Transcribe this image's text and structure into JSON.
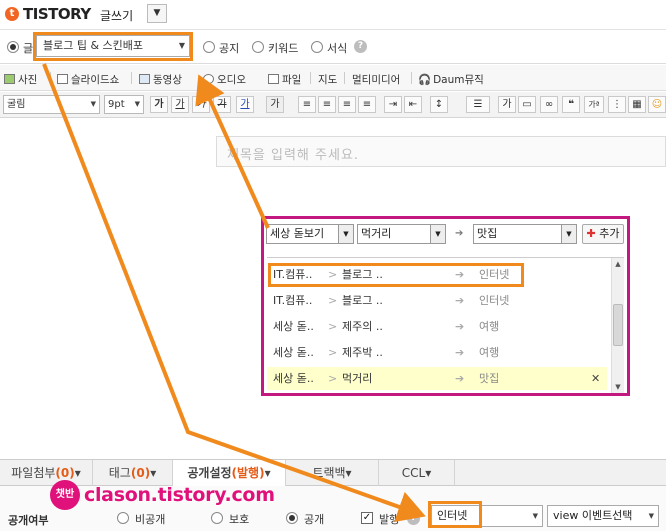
{
  "app": {
    "logo_badge": "t",
    "logo": "TISTORY",
    "subtitle": "글쓰기",
    "dropdown_arrow": "▼"
  },
  "category_row": {
    "type_selected": "글",
    "category_value": "블로그 팁 & 스킨배포",
    "options": [
      "공지",
      "키워드",
      "서식"
    ],
    "help": "?"
  },
  "media_toolbar": [
    "사진",
    "슬라이드쇼",
    "동영상",
    "오디오",
    "파일",
    "지도",
    "멀티미디어",
    "Daum뮤직"
  ],
  "format_toolbar": {
    "font": "굴림",
    "size": "9pt",
    "buttons": [
      "가",
      "가",
      "가",
      "가",
      "가",
      "가",
      "가"
    ]
  },
  "editor": {
    "title_placeholder": "제목을 입력해 주세요."
  },
  "panel": {
    "select1": "세상 돋보기",
    "select2": "먹거리",
    "select3": "맛집",
    "arrow": "➔",
    "add_label": "추가",
    "add_plus": "✚",
    "rows": [
      {
        "c1": "IT.컴퓨..",
        "c2": "블로그 ..",
        "c3": "인터넷"
      },
      {
        "c1": "IT.컴퓨..",
        "c2": "블로그 ..",
        "c3": "인터넷"
      },
      {
        "c1": "세상 돋..",
        "c2": "제주의 ..",
        "c3": "여행"
      },
      {
        "c1": "세상 돋..",
        "c2": "제주박 ..",
        "c3": "여행"
      },
      {
        "c1": "세상 돋..",
        "c2": "먹거리",
        "c3": "맛집",
        "remove": "✕"
      }
    ],
    "sep": ">",
    "sep_arrow": "➔"
  },
  "tabs": [
    {
      "label": "파일첨부",
      "count": "(0)"
    },
    {
      "label": "태그",
      "count": "(0)"
    },
    {
      "label": "공개설정",
      "count": "(발행)"
    },
    {
      "label": "트랙백",
      "count": ""
    },
    {
      "label": "CCL",
      "count": ""
    }
  ],
  "tab_arrow": "▾",
  "bottom": {
    "label": "공개여부",
    "options": [
      "비공개",
      "보호",
      "공개"
    ],
    "publish_label": "발행",
    "publish_check": "✓",
    "help": "?",
    "category_select": "인터넷",
    "event_select": "view 이벤트선택"
  },
  "watermark": {
    "badge": "챗반",
    "text": "clason.tistory.com"
  },
  "colors": {
    "accent_orange": "#f08a1d",
    "panel_border": "#c2187f",
    "tistory_orange": "#f26522",
    "watermark": "#e0117a"
  }
}
